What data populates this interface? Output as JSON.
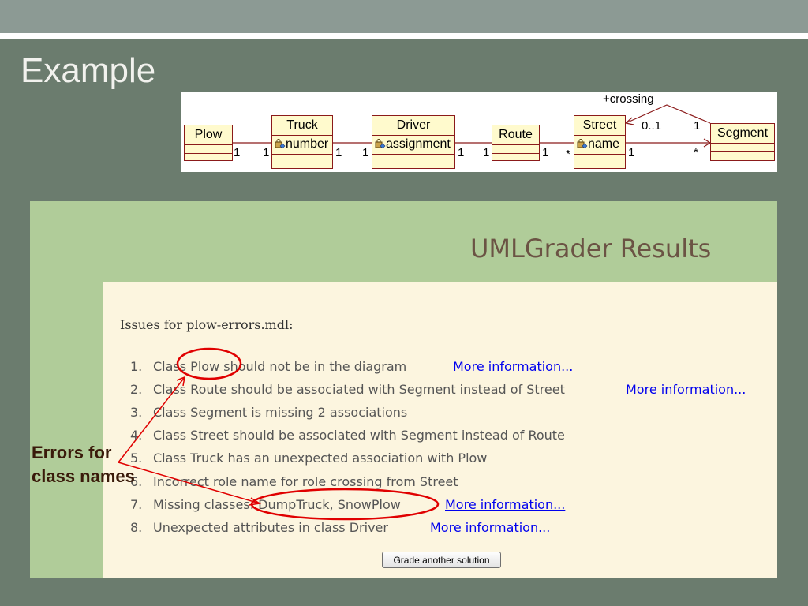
{
  "slide": {
    "title": "Example"
  },
  "uml": {
    "classes": {
      "plow": {
        "name": "Plow"
      },
      "truck": {
        "name": "Truck",
        "attribute": "number"
      },
      "driver": {
        "name": "Driver",
        "attribute": "assignment"
      },
      "route": {
        "name": "Route"
      },
      "street": {
        "name": "Street",
        "attribute": "name"
      },
      "segment": {
        "name": "Segment"
      }
    },
    "multiplicities": {
      "plow_truck": [
        "1",
        "1"
      ],
      "truck_driver": [
        "1",
        "1"
      ],
      "driver_route": [
        "1",
        "1"
      ],
      "route_street": [
        "1",
        "*"
      ],
      "street_segment": [
        "1",
        "*"
      ],
      "crossing": [
        "0..1",
        "1"
      ]
    },
    "role": "+crossing",
    "colors": {
      "class_fill": "#fffacd",
      "class_border": "#8b1a1a",
      "association": "#8b1a1a"
    }
  },
  "results": {
    "title": "UMLGrader Results",
    "issues_heading": "Issues for plow-errors.mdl:",
    "issues": [
      {
        "num": "1.",
        "text": "Class Plow should not be in the diagram",
        "link": "More information..."
      },
      {
        "num": "2.",
        "text": "Class Route should be associated with Segment instead of Street",
        "link": "More information..."
      },
      {
        "num": "3.",
        "text": "Class Segment is missing 2 associations",
        "link": ""
      },
      {
        "num": "4.",
        "text": "Class Street should be associated with Segment instead of Route",
        "link": ""
      },
      {
        "num": "5.",
        "text": "Class Truck has an unexpected association with Plow",
        "link": ""
      },
      {
        "num": "6.",
        "text": "Incorrect role name for role crossing from Street",
        "link": ""
      },
      {
        "num": "7.",
        "text": "Missing classes: DumpTruck, SnowPlow",
        "link": "More information..."
      },
      {
        "num": "8.",
        "text": "Unexpected attributes in class Driver",
        "link": "More information..."
      }
    ],
    "button": "Grade another solution",
    "colors": {
      "panel": "#b0cc99",
      "content": "#fcf5df",
      "link": "#0000ee",
      "title": "#6b5344"
    }
  },
  "annotation": {
    "line1": "Errors for",
    "line2": "class names",
    "color": "#e00000"
  }
}
